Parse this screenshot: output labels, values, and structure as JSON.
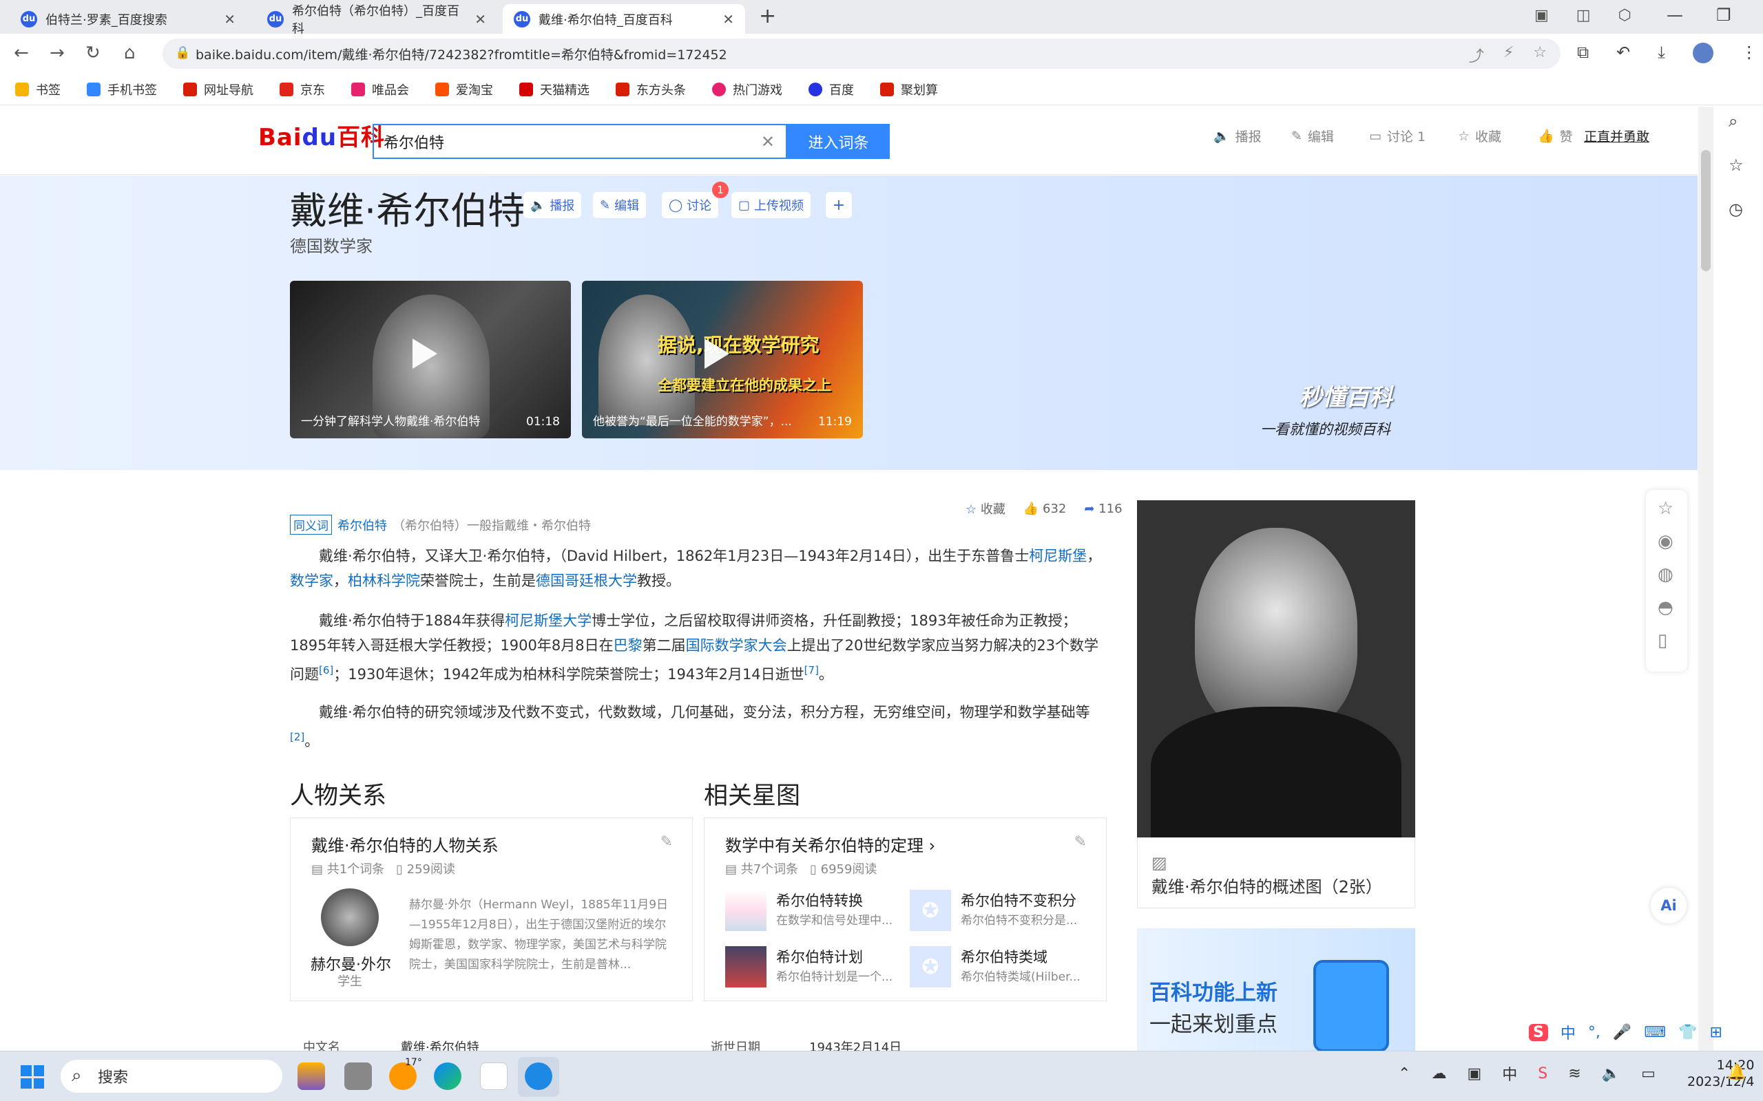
{
  "browser": {
    "tabs": [
      {
        "label": "伯特兰·罗素_百度搜索",
        "active": false
      },
      {
        "label": "希尔伯特（希尔伯特）_百度百科",
        "active": false
      },
      {
        "label": "戴维·希尔伯特_百度百科",
        "active": true
      }
    ],
    "new_tab": "+",
    "url": "baike.baidu.com/item/戴维·希尔伯特/7242382?fromtitle=希尔伯特&fromid=172452",
    "bookmarks": [
      {
        "label": "书签",
        "color": "#f4b400"
      },
      {
        "label": "手机书签",
        "color": "#3388ff"
      },
      {
        "label": "网址导航",
        "color": "#d81e06"
      },
      {
        "label": "京东",
        "color": "#e1251b"
      },
      {
        "label": "唯品会",
        "color": "#e6226e"
      },
      {
        "label": "爱淘宝",
        "color": "#ff5000"
      },
      {
        "label": "天猫精选",
        "color": "#d50000"
      },
      {
        "label": "东方头条",
        "color": "#d81e06"
      },
      {
        "label": "热门游戏",
        "color": "#e6226e"
      },
      {
        "label": "百度",
        "color": "#2932e1"
      },
      {
        "label": "聚划算",
        "color": "#d81e06"
      }
    ]
  },
  "header": {
    "logo_bai": "Bai",
    "logo_du": "du",
    "logo_baike": "百科",
    "search_value": "希尔伯特",
    "search_button": "进入词条",
    "actions": {
      "broadcast": "播报",
      "edit": "编辑",
      "discuss": "讨论 1",
      "collect": "收藏",
      "like": "赞",
      "honest": "正直并勇敢"
    }
  },
  "entry": {
    "title": "戴维·希尔伯特",
    "subtitle": "德国数学家",
    "buttons": {
      "broadcast": "播报",
      "edit": "编辑",
      "discuss": "讨论",
      "discuss_badge": "1",
      "upload_video": "上传视频",
      "add": "+"
    },
    "videos": [
      {
        "caption": "一分钟了解科学人物戴维·希尔伯特",
        "duration": "01:18"
      },
      {
        "caption": "他被誉为“最后一位全能的数学家”，...",
        "duration": "11:19",
        "overlay1": "据说,现在数学研究",
        "overlay2": "全都要建立在他的成果之上"
      }
    ],
    "miaodong": {
      "brand": "秒懂百科",
      "slogan": "一看就懂的视频百科"
    }
  },
  "article": {
    "synonym_tag": "同义词",
    "synonym_link": "希尔伯特",
    "synonym_text": "（希尔伯特）一般指戴维・希尔伯特",
    "stats": {
      "collect": "收藏",
      "likes": "632",
      "shares": "116"
    },
    "p1_a": "戴维·希尔伯特，又译大卫·希尔伯特，（David Hilbert，1862年1月23日—1943年2月14日），出生于东普鲁士",
    "p1_l1": "柯尼斯堡",
    "p1_b": "，",
    "p1_l2": "数学家",
    "p1_c": "，",
    "p1_l3": "柏林科学院",
    "p1_d": "荣誉院士，生前是",
    "p1_l4": "德国哥廷根大学",
    "p1_e": "教授。",
    "p2_a": "戴维·希尔伯特于1884年获得",
    "p2_l1": "柯尼斯堡大学",
    "p2_b": "博士学位，之后留校取得讲师资格，升任副教授；1893年被任命为正教授；1895年转入哥廷根大学任教授；1900年8月8日在",
    "p2_l2": "巴黎",
    "p2_c": "第二届",
    "p2_l3": "国际数学家大会",
    "p2_d": "上提出了20世纪数学家应当努力解决的23个数学问题",
    "p2_ref1": "[6]",
    "p2_e": "；1930年退休；1942年成为柏林科学院荣誉院士；1943年2月14日逝世",
    "p2_ref2": "[7]",
    "p2_f": "。",
    "p3_a": "戴维·希尔伯特的研究领域涉及代数不变式，代数数域，几何基础，变分法，积分方程，无穷维空间，物理学和数学基础等",
    "p3_ref": "[2]",
    "p3_b": "。"
  },
  "relations": {
    "heading": "人物关系",
    "card_title": "戴维·希尔伯特的人物关系",
    "count": "共1个词条",
    "reads": "259阅读",
    "person_name": "赫尔曼·外尔",
    "person_role": "学生",
    "person_desc": "赫尔曼·外尔（Hermann Weyl，1885年11月9日—1955年12月8日），出生于德国汉堡附近的埃尔姆斯霍恩，数学家、物理学家，美国艺术与科学院院士，美国国家科学院院士，生前是普林..."
  },
  "stars": {
    "heading": "相关星图",
    "card_title": "数学中有关希尔伯特的定理",
    "count": "共7个词条",
    "reads": "6959阅读",
    "items": [
      {
        "title": "希尔伯特转换",
        "desc": "在数学和信号处理中..."
      },
      {
        "title": "希尔伯特不变积分",
        "desc": "希尔伯特不变积分是..."
      },
      {
        "title": "希尔伯特计划",
        "desc": "希尔伯特计划是一个..."
      },
      {
        "title": "希尔伯特类域",
        "desc": "希尔伯特类域(Hilber..."
      }
    ]
  },
  "basic_info": {
    "k1": "中文名",
    "v1": "戴维·希尔伯特",
    "k2": "逝世日期",
    "v2": "1943年2月14日"
  },
  "side": {
    "album_caption": "戴维·希尔伯特的概述图（2张）",
    "promo_line1": "百科功能上新",
    "promo_line2": "一起来划重点"
  },
  "taskbar": {
    "search": "搜索",
    "time": "14:20",
    "date": "2023/12/4",
    "weather": "17°",
    "ime": "中"
  }
}
